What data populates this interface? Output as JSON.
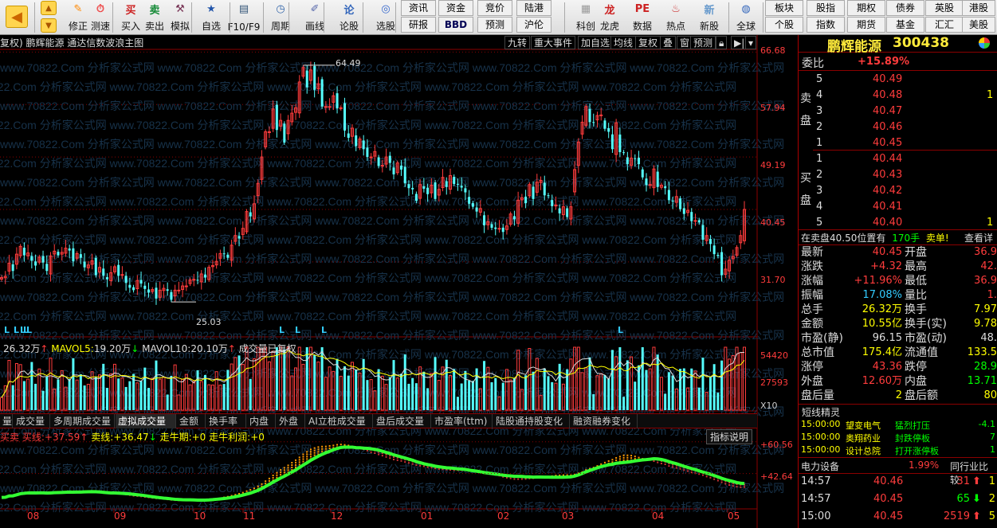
{
  "toolbar": {
    "items": [
      {
        "label": "",
        "icon": "back-arrow-icon"
      },
      {
        "label": "修正",
        "icon": "correct-icon"
      },
      {
        "label": "测速",
        "icon": "speed-test-icon"
      },
      {
        "label": "买入",
        "icon": "buy-icon"
      },
      {
        "label": "卖出",
        "icon": "sell-icon"
      },
      {
        "label": "模拟",
        "icon": "simulate-icon"
      },
      {
        "label": "自选",
        "icon": "favorites-icon"
      },
      {
        "label": "F10/F9",
        "icon": "f10-icon"
      },
      {
        "label": "周期",
        "icon": "period-icon"
      },
      {
        "label": "画线",
        "icon": "draw-line-icon"
      },
      {
        "label": "论股",
        "icon": "discuss-icon"
      },
      {
        "label": "选股",
        "icon": "select-stock-icon"
      },
      {
        "label": "科创",
        "icon": "star-market-icon"
      },
      {
        "label": "龙虎",
        "icon": "dragon-tiger-icon"
      },
      {
        "label": "数据",
        "icon": "data-icon"
      },
      {
        "label": "热点",
        "icon": "hotspot-icon"
      },
      {
        "label": "新股",
        "icon": "new-stock-icon"
      },
      {
        "label": "全球",
        "icon": "globe-icon"
      }
    ],
    "small_top": [
      "资讯",
      "资金",
      "竞价",
      "陆港"
    ],
    "small_bottom": [
      "研报",
      "BBD",
      "预测",
      "沪伦"
    ],
    "right_top": [
      "板块",
      "股指",
      "期权",
      "债券",
      "英股",
      "港股"
    ],
    "right_bottom": [
      "个股",
      "指数",
      "期货",
      "基金",
      "汇汇",
      "美股"
    ]
  },
  "chart": {
    "title": "复权) 鹏辉能源 通达信数波浪主图",
    "top_buttons": [
      "九转",
      "重大事件",
      "加自选",
      "均线",
      "复权",
      "叠",
      "窗",
      "预测"
    ],
    "price_axis": [
      "66.68",
      "57.94",
      "49.19",
      "40.45",
      "31.70"
    ],
    "high_marker": "64.49",
    "low_marker": "25.03",
    "watermark": "www.70822.Com 分析家公式网",
    "volume_info": {
      "vol": "26.32万",
      "mavol5_label": "MAVOL5:",
      "mavol5": "19.20万",
      "mavol10_label": "MAVOL10:",
      "mavol10": "20.10万",
      "note": "成交量已复权"
    },
    "volume_axis": [
      "54420",
      "27593",
      "X10"
    ],
    "tabs": [
      "量",
      "成交量",
      "多周期成交量",
      "虚拟成交量",
      "金额",
      "换手率",
      "内盘",
      "外盘",
      "AI立桩成交量",
      "盘后成交量",
      "市盈率(ttm)",
      "陆股通持股变化",
      "融资融券变化"
    ],
    "active_tab": "虚拟成交量",
    "indicator_info": {
      "a": "买卖",
      "b_label": "买线:",
      "b": "+37.59",
      "c_label": "卖线:",
      "c": "+36.47",
      "d_label": "走牛期:",
      "d": "+0",
      "e_label": "走牛利润:",
      "e": "+0"
    },
    "indicator_button": "指标说明",
    "indicator_axis": [
      "+60.56",
      "+42.64"
    ],
    "months": [
      "08",
      "09",
      "10",
      "11",
      "12",
      "01",
      "02",
      "03",
      "04",
      "05"
    ]
  },
  "chart_data": [
    {
      "type": "candlestick",
      "title": "通达信数波浪主图",
      "yaxis_ticks": [
        66.68,
        57.94,
        49.19,
        40.45,
        31.7
      ],
      "ylim": [
        22,
        67
      ],
      "high": 64.49,
      "low": 25.03,
      "close": [
        29.1,
        29.3,
        31.5,
        30.2,
        33.0,
        34.3,
        32.8,
        33.2,
        31.9,
        31.1,
        32.5,
        31.6,
        30.2,
        32.7,
        33.5,
        32.8,
        33.3,
        34.0,
        33.6,
        31.8,
        33.1,
        32.4,
        30.8,
        31.2,
        31.9,
        29.5,
        30.8,
        29.4,
        28.8,
        29.9,
        30.9,
        29.4,
        29.6,
        28.2,
        27.4,
        27.0,
        28.6,
        28.1,
        27.2,
        26.6,
        27.1,
        25.6,
        27.0,
        27.3,
        26.9,
        25.4,
        27.0,
        27.0,
        27.7,
        27.7,
        28.7,
        28.8,
        28.6,
        29.7,
        29.1,
        30.8,
        31.1,
        31.8,
        33.1,
        33.0,
        32.4,
        34.5,
        36.1,
        35.6,
        37.3,
        40.1,
        39.3,
        41.4,
        44.8,
        49.2,
        53.4,
        53.4,
        57.2,
        53.7,
        55.3,
        51.6,
        55.3,
        56.5,
        57.4,
        61.7,
        64.1,
        60.8,
        63.7,
        60.4,
        61.4,
        57.6,
        57.6,
        57.6,
        59.4,
        57.3,
        57.4,
        53.6,
        52.4,
        54.0,
        51.0,
        52.2,
        50.5,
        49.2,
        49.2,
        50.1,
        47.7,
        47.8,
        49.2,
        48.2,
        46.3,
        48.2,
        47.1,
        44.8,
        44.0,
        43.8,
        41.9,
        44.6,
        43.9,
        43.0,
        44.5,
        42.2,
        43.8,
        45.8,
        44.2,
        46.1,
        44.7,
        44.6,
        44.1,
        43.3,
        41.4,
        40.9,
        40.1,
        40.6,
        37.8,
        38.4,
        37.4,
        37.2,
        37.3,
        36.7,
        37.7,
        39.7,
        38.8,
        42.0,
        42.4,
        41.5,
        44.6,
        42.2,
        45.0,
        45.3,
        42.8,
        42.7,
        41.0,
        41.2,
        39.8,
        40.9,
        39.2,
        40.9,
        47.1,
        51.7,
        55.0,
        57.6,
        55.0,
        54.9,
        56.1,
        56.2,
        53.9,
        53.4,
        50.5,
        54.9,
        50.0,
        49.9,
        48.0,
        49.0,
        48.9,
        48.0,
        45.8,
        44.5,
        44.6,
        47.2,
        44.2,
        44.5,
        44.0,
        42.0,
        41.8,
        42.6,
        40.5,
        39.7,
        40.3,
        38.5,
        38.6,
        38.3,
        35.4,
        36.1,
        34.7,
        33.0,
        32.7,
        29.5,
        30.5,
        32.0,
        32.6,
        34.1,
        36.1,
        40.45
      ],
      "low_markers": [
        5,
        17,
        25,
        29,
        33,
        357,
        373,
        407,
        777
      ]
    },
    {
      "type": "bar",
      "title": "成交量",
      "series": [
        {
          "name": "VOL",
          "unit": "手"
        },
        {
          "name": "MAVOL5"
        },
        {
          "name": "MAVOL10"
        }
      ],
      "yaxis_ticks": [
        54420,
        27593
      ],
      "multiplier": "X10",
      "latest": "26.32万",
      "mavol5": "19.20万",
      "mavol10": "20.10万"
    },
    {
      "type": "line",
      "title": "虚拟成交量",
      "series": [
        {
          "name": "买线",
          "last": 37.59
        },
        {
          "name": "卖线",
          "last": 36.47
        }
      ],
      "yaxis_ticks": [
        60.56,
        42.64
      ],
      "categories": [
        "08",
        "09",
        "10",
        "11",
        "12",
        "01",
        "02",
        "03",
        "04",
        "05"
      ]
    }
  ],
  "panel": {
    "stock_name": "鹏辉能源",
    "stock_code": "300438",
    "weibi_label": "委比",
    "weibi": "+15.89%",
    "sell_label": "卖盘",
    "buy_label": "买盘",
    "asks": [
      {
        "lv": "5",
        "p": "40.49",
        "v": ""
      },
      {
        "lv": "4",
        "p": "40.48",
        "v": "1"
      },
      {
        "lv": "3",
        "p": "40.47",
        "v": ""
      },
      {
        "lv": "2",
        "p": "40.46",
        "v": ""
      },
      {
        "lv": "1",
        "p": "40.45",
        "v": ""
      }
    ],
    "bids": [
      {
        "lv": "1",
        "p": "40.44",
        "v": ""
      },
      {
        "lv": "2",
        "p": "40.43",
        "v": ""
      },
      {
        "lv": "3",
        "p": "40.42",
        "v": ""
      },
      {
        "lv": "4",
        "p": "40.41",
        "v": ""
      },
      {
        "lv": "5",
        "p": "40.40",
        "v": "1"
      }
    ],
    "notice": {
      "a": "在卖盘40.50位置有",
      "b": "170手",
      "c": "卖单!",
      "d": "查看详"
    },
    "stats": [
      {
        "l1": "最新",
        "v1": "40.45",
        "l2": "开盘",
        "v2": "36.9"
      },
      {
        "l1": "涨跌",
        "v1": "+4.32",
        "l2": "最高",
        "v2": "42."
      },
      {
        "l1": "涨幅",
        "v1": "+11.96%",
        "l2": "最低",
        "v2": "36.9"
      },
      {
        "l1": "振幅",
        "v1": "17.08%",
        "l2": "量比",
        "v2": "1."
      },
      {
        "l1": "总手",
        "v1": "26.32万",
        "l2": "换手",
        "v2": "7.97"
      },
      {
        "l1": "金额",
        "v1": "10.55亿",
        "l2": "换手(实)",
        "v2": "9.78"
      },
      {
        "l1": "市盈(静)",
        "v1": "96.15",
        "l2": "市盈(动)",
        "v2": "48."
      },
      {
        "l1": "总市值",
        "v1": "175.4亿",
        "l2": "流通值",
        "v2": "133.5"
      },
      {
        "l1": "涨停",
        "v1": "43.36",
        "l2": "跌停",
        "v2": "28.9"
      },
      {
        "l1": "外盘",
        "v1": "12.60万",
        "l2": "内盘",
        "v2": "13.71"
      },
      {
        "l1": "盘后量",
        "v1": "2",
        "l2": "盘后额",
        "v2": "80"
      }
    ],
    "short_title": "短线精灵",
    "short_items": [
      {
        "t": "15:00:00",
        "n": "望变电气",
        "a": "猛烈打压",
        "v": "-4.1"
      },
      {
        "t": "15:00:00",
        "n": "奥翔药业",
        "a": "封跌停板",
        "v": "7"
      },
      {
        "t": "15:00:00",
        "n": "设计总院",
        "a": "打开涨停板",
        "v": "1"
      }
    ],
    "sector": {
      "name": "电力设备",
      "pct": "1.99%",
      "btn": "同行业比较"
    },
    "ticks": [
      {
        "t": "14:57",
        "p": "40.46",
        "v": "31",
        "dir": "up"
      },
      {
        "t": "14:57",
        "p": "40.45",
        "v": "65",
        "dir": "down"
      },
      {
        "t": "15:00",
        "p": "40.45",
        "v": "2519",
        "dir": "up"
      }
    ],
    "tick_tail": [
      "1",
      "2",
      "5"
    ]
  }
}
